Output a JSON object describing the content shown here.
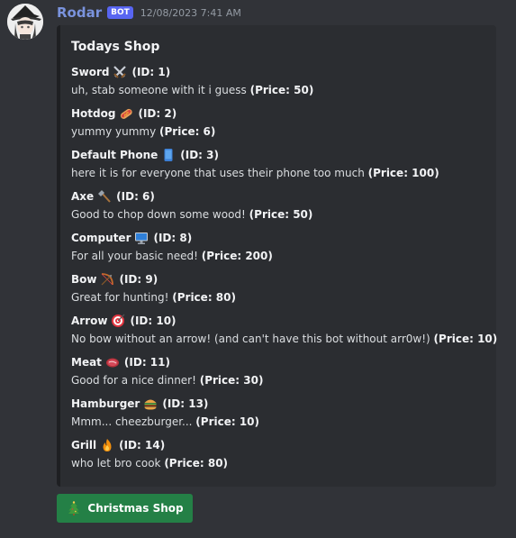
{
  "message": {
    "author": "Rodar",
    "bot_tag": "BOT",
    "timestamp": "12/08/2023 7:41 AM",
    "avatar_icon": "witch-character-avatar"
  },
  "embed": {
    "title": "Todays Shop",
    "items": [
      {
        "name": "Sword",
        "emoji": "crossed-swords",
        "id_label": "(ID: 1)",
        "desc": "uh, stab someone with it i guess ",
        "price": "(Price: 50)"
      },
      {
        "name": "Hotdog",
        "emoji": "hotdog",
        "id_label": "(ID: 2)",
        "desc": "yummy yummy ",
        "price": "(Price: 6)"
      },
      {
        "name": "Default Phone",
        "emoji": "mobile-phone",
        "id_label": "(ID: 3)",
        "desc": "here it is for everyone that uses their phone too much ",
        "price": "(Price: 100)"
      },
      {
        "name": "Axe",
        "emoji": "axe",
        "id_label": "(ID: 6)",
        "desc": "Good to chop down some wood! ",
        "price": "(Price: 50)"
      },
      {
        "name": "Computer",
        "emoji": "desktop-computer",
        "id_label": "(ID: 8)",
        "desc": "For all your basic need! ",
        "price": "(Price: 200)"
      },
      {
        "name": "Bow",
        "emoji": "bow-and-arrow",
        "id_label": "(ID: 9)",
        "desc": "Great for hunting! ",
        "price": "(Price: 80)"
      },
      {
        "name": "Arrow",
        "emoji": "direct-hit-target",
        "id_label": "(ID: 10)",
        "desc": "No bow without an arrow! (and can't have this bot without arr0w!) ",
        "price": "(Price: 10)"
      },
      {
        "name": "Meat",
        "emoji": "steak",
        "id_label": "(ID: 11)",
        "desc": "Good for a nice dinner! ",
        "price": "(Price: 30)"
      },
      {
        "name": "Hamburger",
        "emoji": "hamburger",
        "id_label": "(ID: 13)",
        "desc": "Mmm... cheezburger... ",
        "price": "(Price: 10)"
      },
      {
        "name": "Grill",
        "emoji": "fire",
        "id_label": "(ID: 14)",
        "desc": "who let bro cook ",
        "price": "(Price: 80)"
      }
    ]
  },
  "button": {
    "label": "Christmas Shop",
    "emoji": "christmas-tree",
    "color": "#248046"
  },
  "colors": {
    "background": "#313338",
    "embed_background": "#2b2d31",
    "username": "#7a93dd",
    "bot_tag": "#5865f2"
  }
}
